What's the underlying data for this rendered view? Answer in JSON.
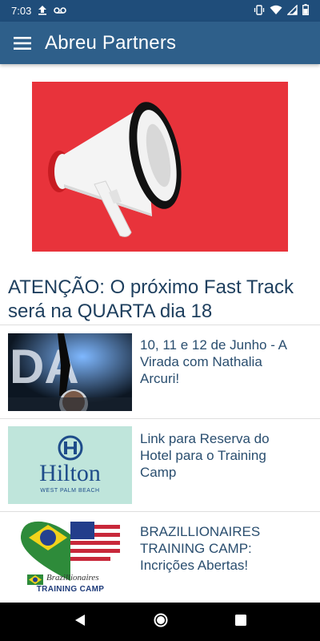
{
  "status_bar": {
    "time": "7:03"
  },
  "app_bar": {
    "title": "Abreu Partners"
  },
  "featured": {
    "headline": "ATENÇÃO: O próximo Fast Track será na QUARTA dia 18"
  },
  "posts": [
    {
      "title": "10, 11 e 12 de Junho - A Virada com Nathalia Arcuri!"
    },
    {
      "title": "Link para Reserva do Hotel para o Training Camp",
      "thumb_text": "Hilton",
      "thumb_subtext": "WEST PALM BEACH"
    },
    {
      "title": "BRAZILLIONAIRES TRAINING CAMP: Incrições Abertas!",
      "thumb_script": "Brazillionaires",
      "thumb_banner": "TRAINING CAMP"
    }
  ],
  "colors": {
    "status_bar": "#1f4d7a",
    "app_bar": "#2e5f8a",
    "text_primary": "#1e3f5e",
    "hero_red": "#e8333b"
  }
}
